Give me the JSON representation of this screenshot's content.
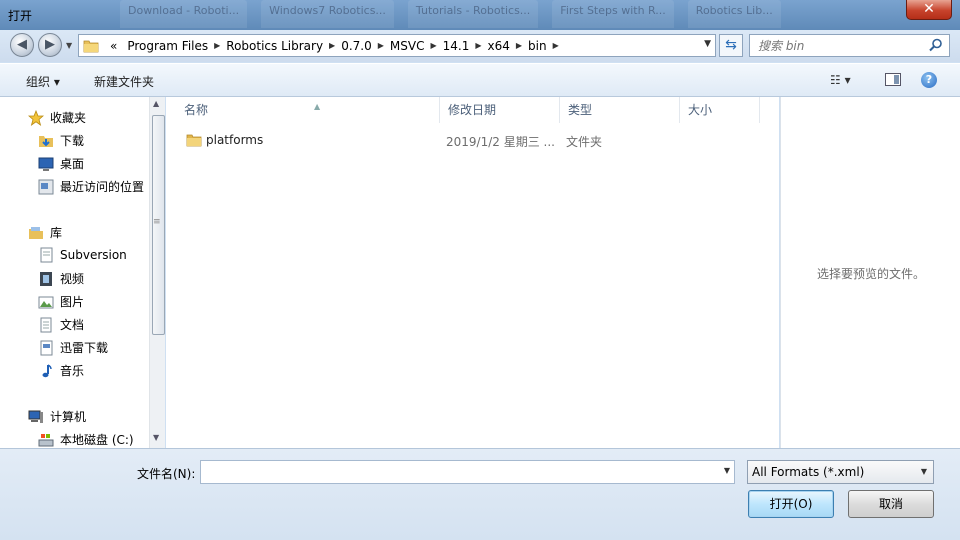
{
  "window": {
    "title": "打开",
    "close_label": "✕",
    "background_tabs": [
      "Download - Roboti...",
      "Windows7 Robotics...",
      "Tutorials - Robotics...",
      "First Steps with R...",
      "Robotics Lib..."
    ]
  },
  "address": {
    "overflow": "«",
    "crumbs": [
      "Program Files",
      "Robotics Library",
      "0.7.0",
      "MSVC",
      "14.1",
      "x64",
      "bin"
    ],
    "search_placeholder": "搜索 bin"
  },
  "toolbar": {
    "organize": "组织 ▾",
    "new_folder": "新建文件夹",
    "views": "☷ ▾",
    "help": "?"
  },
  "nav": {
    "favorites_header": "收藏夹",
    "favorites": [
      "下载",
      "桌面",
      "最近访问的位置"
    ],
    "libraries_header": "库",
    "libraries": [
      "Subversion",
      "视频",
      "图片",
      "文档",
      "迅雷下载",
      "音乐"
    ],
    "computer_header": "计算机",
    "drives": [
      "本地磁盘 (C:)"
    ]
  },
  "list": {
    "columns": [
      "名称",
      "修改日期",
      "类型",
      "大小"
    ],
    "rows": [
      {
        "name": "platforms",
        "date": "2019/1/2 星期三 ...",
        "type": "文件夹",
        "size": ""
      }
    ]
  },
  "preview": {
    "empty_text": "选择要预览的文件。"
  },
  "bottom": {
    "filename_label": "文件名(N):",
    "filename_value": "",
    "format": "All Formats (*.xml)",
    "open_label": "打开(O)",
    "cancel_label": "取消"
  }
}
